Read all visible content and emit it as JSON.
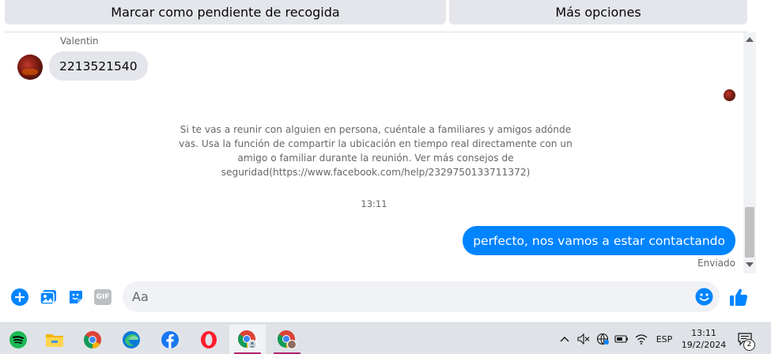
{
  "top_buttons": {
    "mark_pending": "Marcar como pendiente de recogida",
    "more_options": "Más opciones"
  },
  "conversation": {
    "sender_name": "Valentin",
    "incoming_message": "2213521540",
    "safety_note": "Si te vas a reunir con alguien en persona, cuéntale a familiares y amigos adónde vas. Usa la función de compartir la ubicación en tiempo real directamente con un amigo o familiar durante la reunión. Ver más consejos de seguridad(https://www.facebook.com/help/2329750133711372)",
    "timestamp": "13:11",
    "outgoing_message": "perfecto, nos vamos a estar contactando",
    "status": "Enviado"
  },
  "composer": {
    "placeholder": "Aa",
    "gif_label": "GIF"
  },
  "taskbar": {
    "apps": [
      "spotify-icon",
      "file-explorer-icon",
      "chrome-icon",
      "edge-icon",
      "facebook-icon",
      "opera-icon",
      "chrome-profile-icon",
      "chrome-profile-2-icon"
    ],
    "language": "ESP",
    "time": "13:11",
    "date": "19/2/2024",
    "notification_count": "2"
  },
  "colors": {
    "accent": "#0084ff",
    "bubble_in": "#e4e6eb",
    "taskbar": "#dfe3e8"
  }
}
